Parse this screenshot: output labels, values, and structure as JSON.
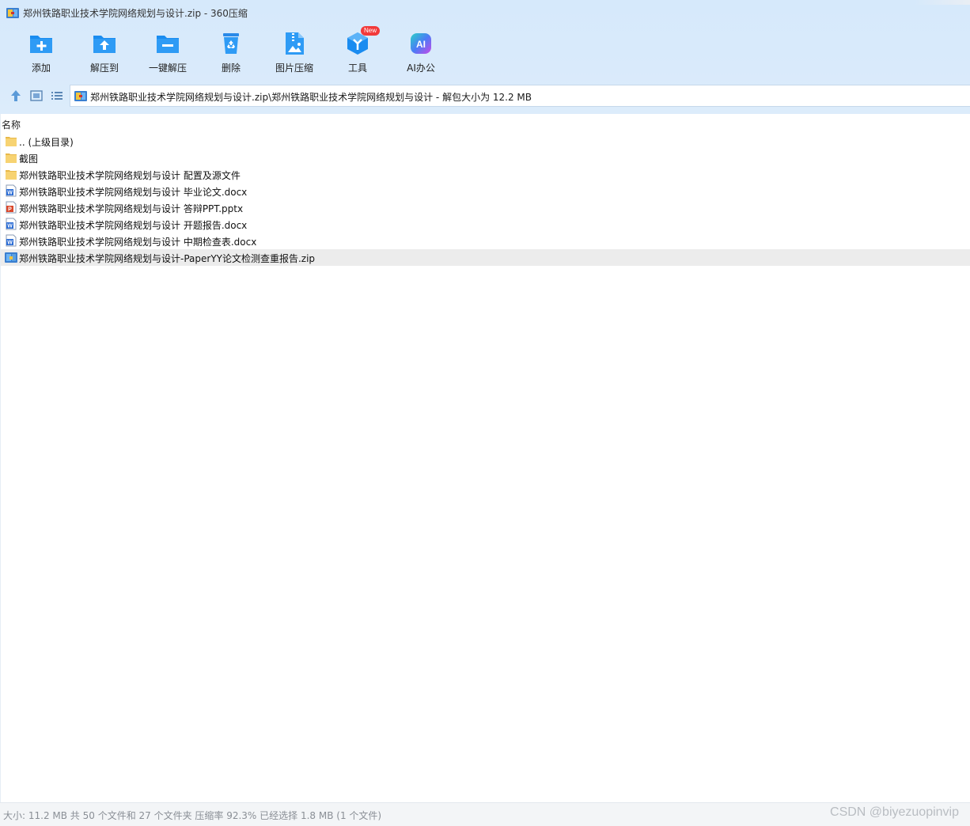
{
  "window": {
    "title": "郑州铁路职业技术学院网络规划与设计.zip - 360压缩"
  },
  "toolbar": {
    "items": [
      {
        "label": "添加",
        "icon": "add-folder-icon"
      },
      {
        "label": "解压到",
        "icon": "extract-to-icon"
      },
      {
        "label": "一键解压",
        "icon": "one-click-extract-icon"
      },
      {
        "label": "删除",
        "icon": "recycle-bin-icon"
      },
      {
        "label": "图片压缩",
        "icon": "image-compress-icon"
      },
      {
        "label": "工具",
        "icon": "tools-icon",
        "badge": "New"
      },
      {
        "label": "AI办公",
        "icon": "ai-office-icon"
      }
    ]
  },
  "nav": {
    "address": "郑州铁路职业技术学院网络规划与设计.zip\\郑州铁路职业技术学院网络规划与设计 - 解包大小为 12.2 MB"
  },
  "list": {
    "column_name": "名称",
    "rows": [
      {
        "name": ".. (上级目录)",
        "type": "folder"
      },
      {
        "name": "截图",
        "type": "folder"
      },
      {
        "name": "郑州铁路职业技术学院网络规划与设计 配置及源文件",
        "type": "folder"
      },
      {
        "name": "郑州铁路职业技术学院网络规划与设计 毕业论文.docx",
        "type": "word"
      },
      {
        "name": "郑州铁路职业技术学院网络规划与设计 答辩PPT.pptx",
        "type": "ppt"
      },
      {
        "name": "郑州铁路职业技术学院网络规划与设计 开题报告.docx",
        "type": "word"
      },
      {
        "name": "郑州铁路职业技术学院网络规划与设计 中期检查表.docx",
        "type": "word"
      },
      {
        "name": "郑州铁路职业技术学院网络规划与设计-PaperYY论文检测查重报告.zip",
        "type": "zip",
        "selected": true
      }
    ]
  },
  "status": {
    "text": "大小: 11.2 MB 共 50 个文件和 27 个文件夹 压缩率 92.3% 已经选择 1.8 MB (1 个文件)",
    "watermark": "CSDN @biyezuopinvip"
  },
  "colors": {
    "accent": "#1a8cf0",
    "folder": "#f7d372",
    "word": "#2b6cd4",
    "ppt": "#d9472b",
    "badge": "#f23a3a"
  }
}
